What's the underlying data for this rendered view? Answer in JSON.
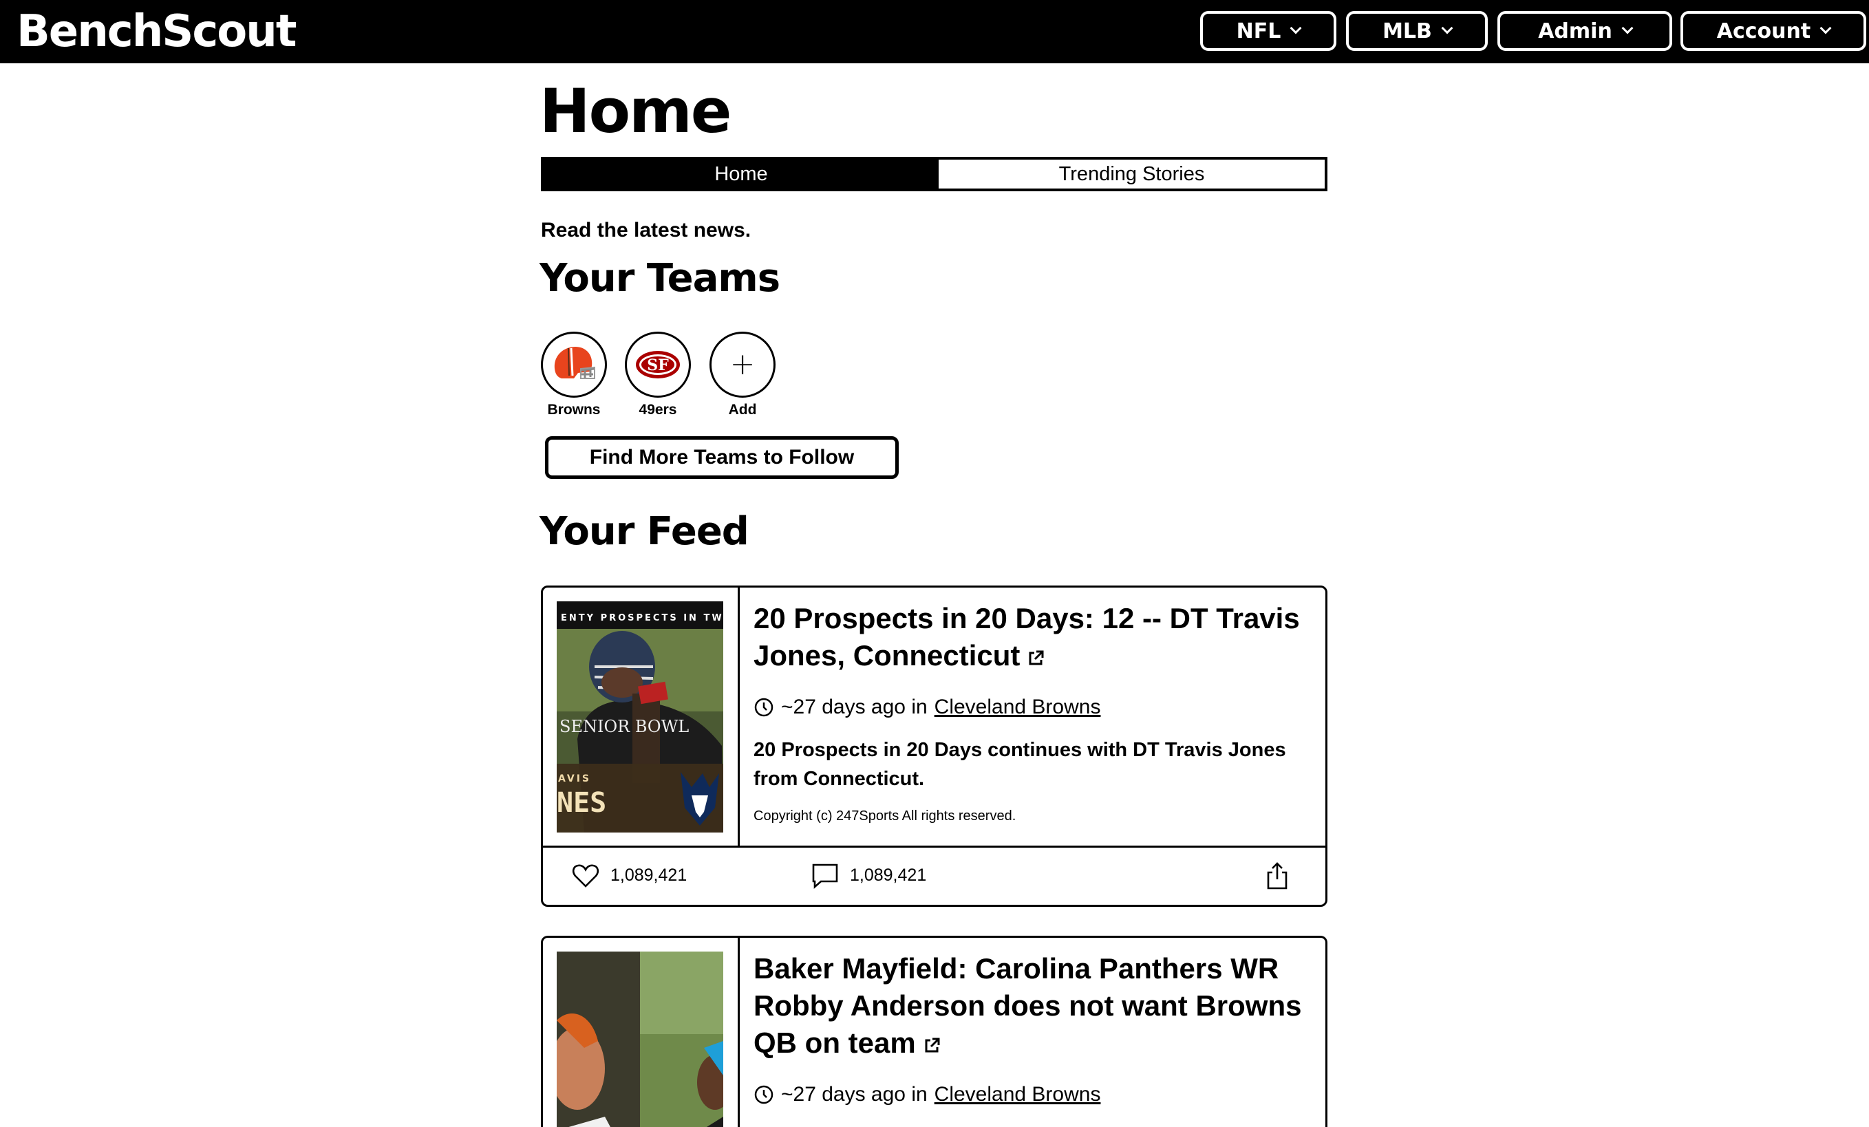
{
  "app": {
    "brand": "BenchScout"
  },
  "nav": [
    {
      "label": "NFL"
    },
    {
      "label": "MLB"
    },
    {
      "label": "Admin"
    },
    {
      "label": "Account"
    }
  ],
  "page": {
    "title": "Home",
    "tabs": [
      {
        "label": "Home",
        "active": true
      },
      {
        "label": "Trending Stories",
        "active": false
      }
    ],
    "intro": "Read the latest news."
  },
  "teams": {
    "heading": "Your Teams",
    "items": [
      {
        "label": "Browns",
        "icon": "browns-helmet-icon"
      },
      {
        "label": "49ers",
        "icon": "49ers-logo-icon"
      },
      {
        "label": "Add",
        "icon": "plus-icon"
      }
    ],
    "find_more_label": "Find More Teams to Follow"
  },
  "feed": {
    "heading": "Your Feed",
    "stories": [
      {
        "title": "20 Prospects in 20 Days: 12 -- DT Travis Jones, Connecticut",
        "age": "~27 days ago in",
        "team": "Cleveland Browns",
        "description": "20 Prospects in 20 Days continues with DT Travis Jones from Connecticut.",
        "copyright": "Copyright (c) 247Sports All rights reserved.",
        "likes": "1,089,421",
        "comments": "1,089,421",
        "thumb_banner": "ENTY PROSPECTS IN TW",
        "thumb_jersey": "SENIOR BOWL",
        "thumb_name_top": "AVIS",
        "thumb_name": "NES"
      },
      {
        "title": "Baker Mayfield: Carolina Panthers WR Robby Anderson does not want Browns QB on team",
        "age": "~27 days ago in",
        "team": "Cleveland Browns"
      }
    ]
  },
  "colors": {
    "topbar": "#000000",
    "accent": "#000000",
    "browns_orange": "#E8441D",
    "niners_red": "#AA0000"
  }
}
